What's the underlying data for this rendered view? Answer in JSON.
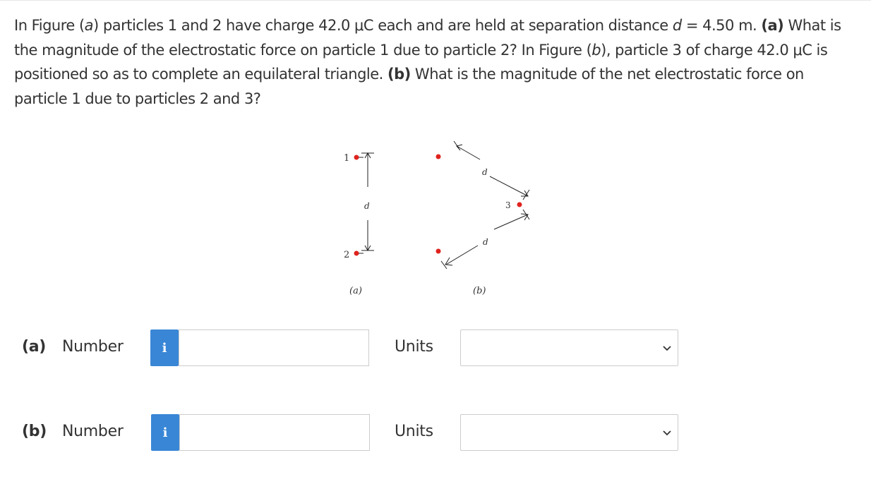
{
  "question": {
    "p1": "In Figure (",
    "p2": "a",
    "p3": ") particles 1 and 2 have charge 42.0 μC each and are held at separation distance ",
    "p4": "d",
    "p5": " = 4.50 m. ",
    "p6": "(a)",
    "p7": " What is the magnitude of the electrostatic force on particle 1 due to particle 2? In Figure (",
    "p8": "b",
    "p9": "), particle 3 of charge 42.0 μC is positioned so as to complete an equilateral triangle. ",
    "p10": "(b)",
    "p11": " What is the magnitude of the net electrostatic force on particle 1 due to particles 2 and 3?"
  },
  "figure": {
    "label_particle_1": "1",
    "label_particle_2": "2",
    "label_particle_3": "3",
    "label_d": "d",
    "caption_a": "(a)",
    "caption_b": "(b)",
    "charge_color": "#e0231e"
  },
  "answers": [
    {
      "part": "(a)",
      "number_label": "Number",
      "info_icon": "i",
      "value": "",
      "units_label": "Units",
      "units_selected": "",
      "chevron_icon": "chevron-down-icon"
    },
    {
      "part": "(b)",
      "number_label": "Number",
      "info_icon": "i",
      "value": "",
      "units_label": "Units",
      "units_selected": "",
      "chevron_icon": "chevron-down-icon"
    }
  ],
  "colors": {
    "info_button": "#3a86d6",
    "input_border": "#cccccc",
    "text": "#333333"
  }
}
